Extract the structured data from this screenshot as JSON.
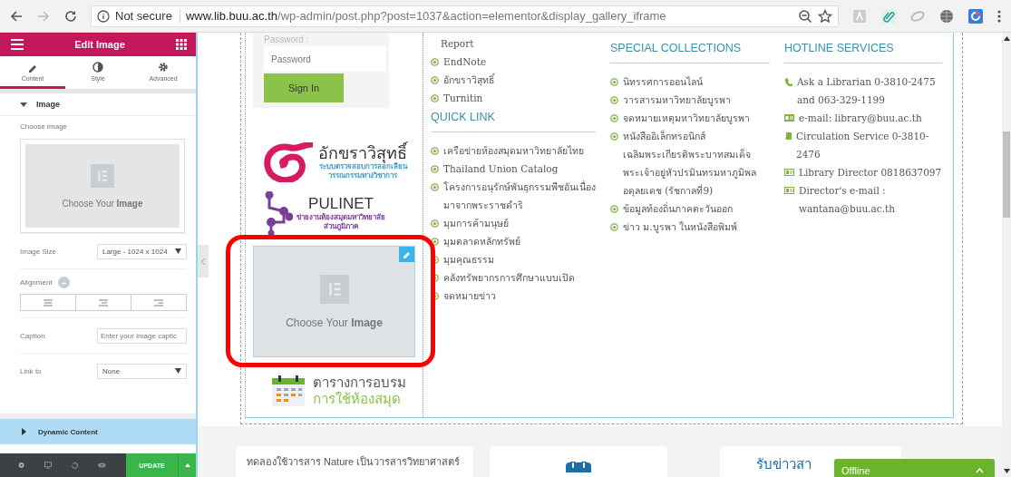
{
  "browser": {
    "security_label": "Not secure",
    "url_host": "www.lib.buu.ac.th",
    "url_path": "/wp-admin/post.php?post=1037&action=elementor&display_gallery_iframe"
  },
  "editor": {
    "title": "Edit Image",
    "tabs": [
      {
        "label": "Content",
        "kind": "pencil",
        "selected": true
      },
      {
        "label": "Style",
        "kind": "contrast",
        "selected": false
      },
      {
        "label": "Advanced",
        "kind": "gear",
        "selected": false
      }
    ],
    "section": {
      "label": "Image",
      "expanded": true
    },
    "choose_image": {
      "label": "Choose Image",
      "prompt": "Choose Your **Image**"
    },
    "image_size": {
      "label": "Image Size",
      "value": "Large - 1024 x 1024"
    },
    "alignment": {
      "label": "Alignment",
      "options": [
        {
          "kind": "left"
        },
        {
          "kind": "center"
        },
        {
          "kind": "right"
        }
      ]
    },
    "caption": {
      "label": "Caption",
      "placeholder": "Enter your image captic"
    },
    "link_to": {
      "label": "Link to",
      "value": "None"
    },
    "collapsed_section": {
      "label": "Dynamic Content",
      "expanded": false
    },
    "footer": {
      "button": "UPDATE"
    }
  },
  "preview": {
    "login": {
      "label": "Password :",
      "placeholder": "Password",
      "button": "Sign In"
    },
    "logos": [
      {
        "kind": "akara",
        "title": "อักขราวิสุทธิ์",
        "subtitle_lines": [
          "ระบบตรวจสอบการลอกเลียน",
          "วรรณกรรมทางวิชาการ"
        ]
      },
      {
        "kind": "pulinet",
        "title": "PULINET",
        "subtitle_lines": [
          "ข่ายงานห้องสมุดมหาวิทยาลัย",
          "ส่วนภูมิภาค"
        ]
      }
    ],
    "image_widget": {
      "prompt": "Choose Your **Image**",
      "highlighted": true
    },
    "calendar_logo": {
      "title": "ตารางการอบรม",
      "subtitle": "การใช้ห้องสมุด"
    },
    "columns": [
      {
        "blocks": [
          {
            "items": [
              {
                "kind": "plain",
                "text": "Report"
              },
              {
                "kind": "bullet",
                "text": "EndNote"
              },
              {
                "kind": "bullet",
                "text": "อักขราวิสุทธิ์"
              },
              {
                "kind": "bullet",
                "text": "Turnitin"
              }
            ]
          },
          {
            "heading": "QUICK LINK",
            "items": [
              {
                "kind": "bullet",
                "text": "เครือข่ายห้องสมุดมหาวิทยาลัยไทย"
              },
              {
                "kind": "bullet",
                "text": "Thailand Union Catalog"
              },
              {
                "kind": "bullet",
                "text": "โครงการอนุรักษ์พันธุกรรมพืชอันเนื่องมาจากพระราชดำริ"
              },
              {
                "kind": "bullet",
                "text": "มุมการค้ามนุษย์"
              },
              {
                "kind": "bullet",
                "text": "มุมตลาดหลักทรัพย์"
              },
              {
                "kind": "bullet",
                "text": "มุมคุณธรรม"
              },
              {
                "kind": "bullet",
                "text": "คลังทรัพยากรการศึกษาแบบเปิด"
              },
              {
                "kind": "bullet",
                "text": "จดหมายข่าว"
              }
            ]
          }
        ]
      },
      {
        "blocks": [
          {
            "heading": "SPECIAL COLLECTIONS",
            "items": [
              {
                "kind": "bullet",
                "text": "นิทรรศการออนไลน์"
              },
              {
                "kind": "bullet",
                "text": "วารสารมหาวิทยาลัยบูรพา"
              },
              {
                "kind": "bullet",
                "text": "จดหมายเหตุมหาวิทยาลัยบูรพา"
              },
              {
                "kind": "bullet",
                "text": "หนังสืออิเล็กทรอนิกส์เฉลิมพระเกียรติพระบาทสมเด็จพระเจ้าอยู่หัวปรมินทรมหาภูมิพลอดุลยเดช (รัชกาลที่9)"
              },
              {
                "kind": "bullet",
                "text": "ข้อมูลท้องถิ่นภาคตะวันออก"
              },
              {
                "kind": "bullet",
                "text": "ข่าว ม.บูรพา ในหนังสือพิมพ์"
              }
            ]
          }
        ]
      },
      {
        "blocks": [
          {
            "heading": "HOTLINE SERVICES",
            "items": [
              {
                "kind": "phone",
                "text": "Ask a Librarian 0-3810-2475 and 063-329-1199"
              },
              {
                "kind": "mail",
                "text": "e-mail: library@buu.ac.th"
              },
              {
                "kind": "book",
                "text": "Circulation Service 0-3810-2476"
              },
              {
                "kind": "card",
                "text": "Library Director 0818637097"
              },
              {
                "kind": "card",
                "text": "Director's e-mail : wantana@buu.ac.th"
              }
            ]
          }
        ]
      }
    ],
    "cards": [
      {
        "kind": "text",
        "text": "ทดลองใช้วารสาร Nature เป็นวารสารวิทยาศาสตร์"
      },
      {
        "kind": "icon"
      },
      {
        "kind": "text",
        "text": "รับข่าวสา"
      }
    ],
    "chat_widget": {
      "label": "Offline"
    }
  }
}
